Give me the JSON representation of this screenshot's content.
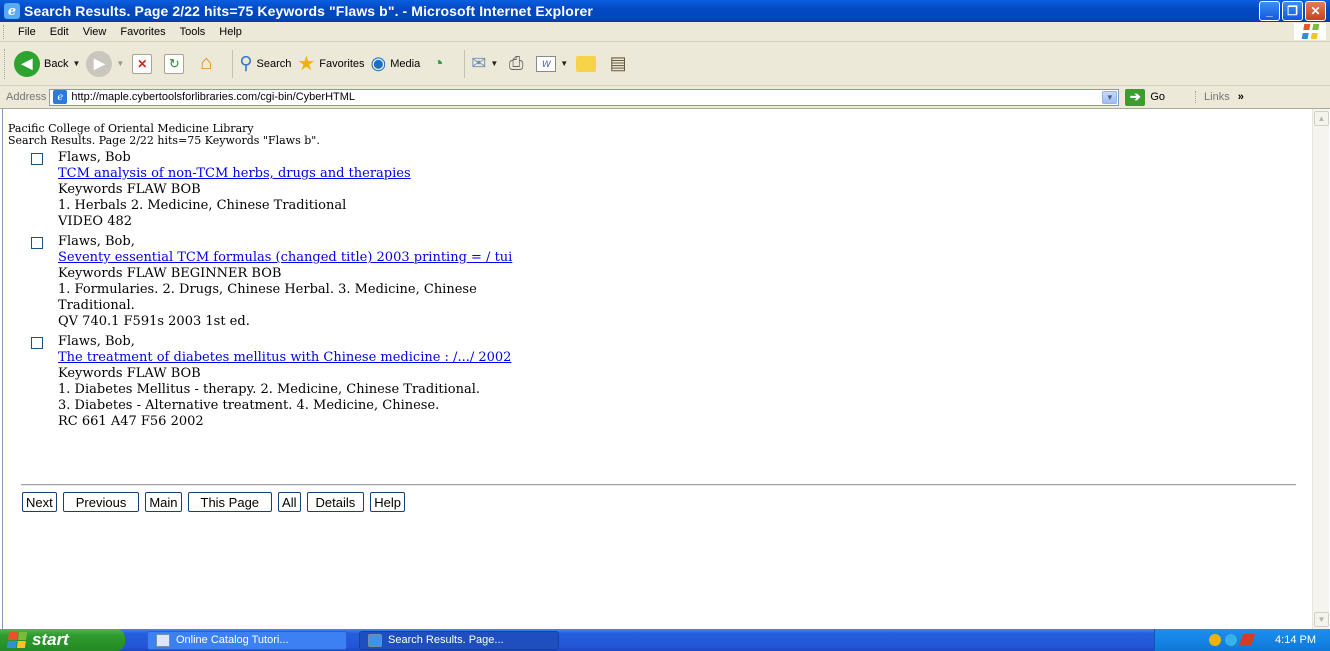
{
  "window": {
    "title": "Search Results. Page 2/22 hits=75 Keywords \"Flaws b\". - Microsoft Internet Explorer"
  },
  "menu": [
    "File",
    "Edit",
    "View",
    "Favorites",
    "Tools",
    "Help"
  ],
  "toolbar": {
    "back_label": "Back",
    "search_label": "Search",
    "favorites_label": "Favorites",
    "media_label": "Media"
  },
  "address": {
    "label": "Address",
    "url": "http://maple.cybertoolsforlibraries.com/cgi-bin/CyberHTML",
    "go_label": "Go",
    "links_label": "Links"
  },
  "page": {
    "library_name": "Pacific College of Oriental Medicine Library",
    "summary": "Search Results. Page 2/22 hits=75 Keywords \"Flaws b\".",
    "records": [
      {
        "author": "Flaws, Bob",
        "title": "TCM analysis of non-TCM herbs, drugs and therapies",
        "lines": [
          "Keywords FLAW BOB",
          "1. Herbals 2. Medicine, Chinese Traditional",
          "VIDEO 482"
        ]
      },
      {
        "author": "Flaws, Bob,",
        "title": "Seventy essential TCM formulas (changed title) 2003 printing = / tui",
        "lines": [
          "Keywords FLAW BEGINNER BOB",
          "1. Formularies. 2. Drugs, Chinese Herbal. 3. Medicine, Chinese",
          "Traditional.",
          "QV 740.1 F591s 2003 1st ed."
        ]
      },
      {
        "author": "Flaws, Bob,",
        "title": "The treatment of diabetes mellitus with Chinese medicine : /.../ 2002",
        "lines": [
          "Keywords FLAW BOB",
          "1. Diabetes Mellitus - therapy. 2. Medicine, Chinese Traditional.",
          "3. Diabetes - Alternative treatment. 4. Medicine, Chinese.",
          "RC 661 A47 F56 2002"
        ]
      }
    ],
    "nav_buttons": [
      "Next",
      "Previous",
      "Main",
      "This Page",
      "All",
      "Details",
      "Help"
    ]
  },
  "taskbar": {
    "start_label": "start",
    "items": [
      "Online Catalog Tutori...",
      "Search Results. Page..."
    ],
    "clock": "4:14 PM"
  },
  "colors": {
    "link": "#0000ee",
    "titlebar": "#0449c2",
    "taskbar": "#245edc",
    "start": "#2f9a2f"
  }
}
